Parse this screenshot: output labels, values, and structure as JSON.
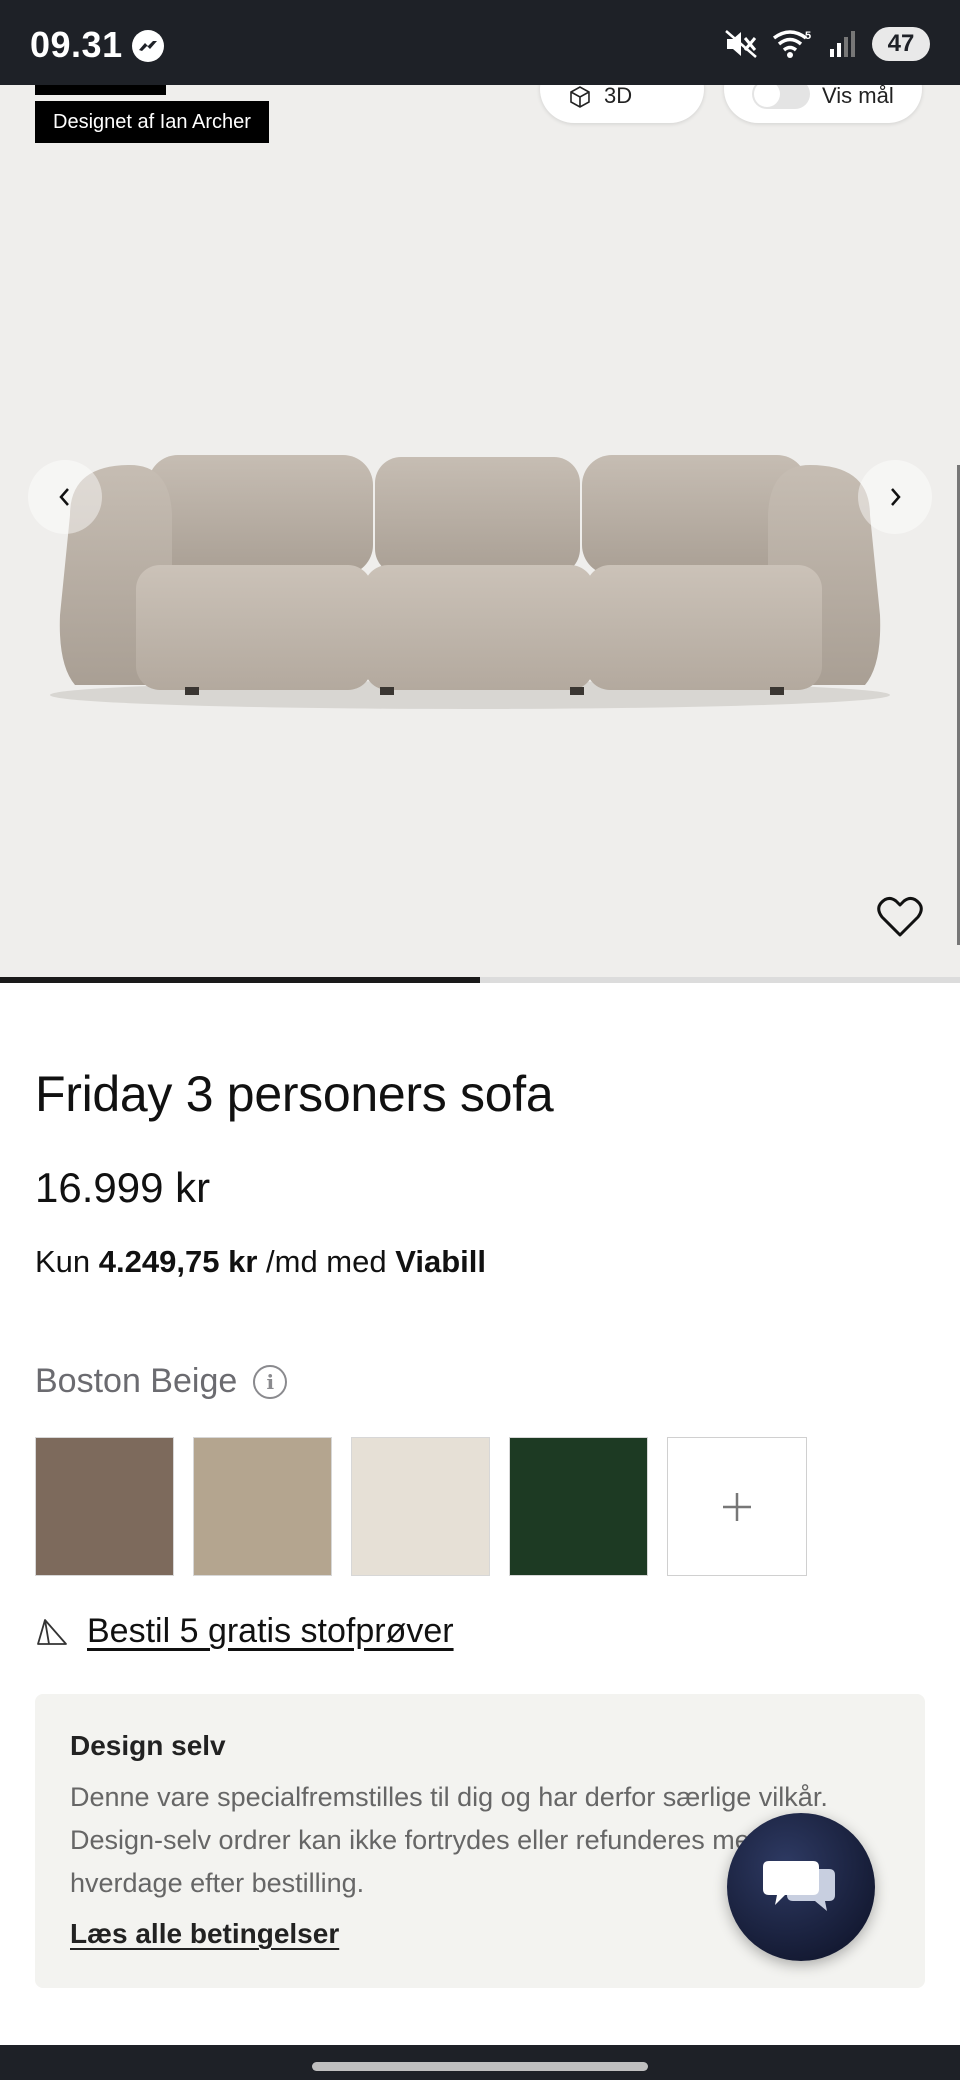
{
  "status_bar": {
    "time": "09.31",
    "battery": "47",
    "network": "5"
  },
  "hero": {
    "designer_tag": "Designet af Ian Archer",
    "view_3d_label": "Se i 3D",
    "show_dimensions_label": "Vis mål",
    "carousel_progress": 0.5
  },
  "product": {
    "title": "Friday 3 personers sofa",
    "price": "16.999 kr",
    "installment": {
      "prefix": "Kun",
      "amount": "4.249,75 kr",
      "middle": "/md med",
      "provider": "Viabill"
    },
    "selected_color": "Boston Beige",
    "swatches": [
      {
        "name": "brown",
        "color": "#7d6a5c"
      },
      {
        "name": "beige",
        "color": "#b4a58f"
      },
      {
        "name": "off-white",
        "color": "#e6e0d6"
      },
      {
        "name": "dark-green",
        "color": "#1d3a23"
      }
    ],
    "samples_link": "Bestil 5 gratis stofprøver"
  },
  "design_box": {
    "title": "Design selv",
    "text": "Denne vare specialfremstilles til dig og har derfor særlige vilkår. Design-selv ordrer kan ikke fortrydes eller refunderes mere end 2 hverdage efter bestilling.",
    "link": "Læs alle betingelser"
  },
  "colors": {
    "status_bar": "#1e2127",
    "hero_bg": "#efeeec",
    "info_box_bg": "#f3f3f0",
    "chat_button": "#1b2242"
  }
}
